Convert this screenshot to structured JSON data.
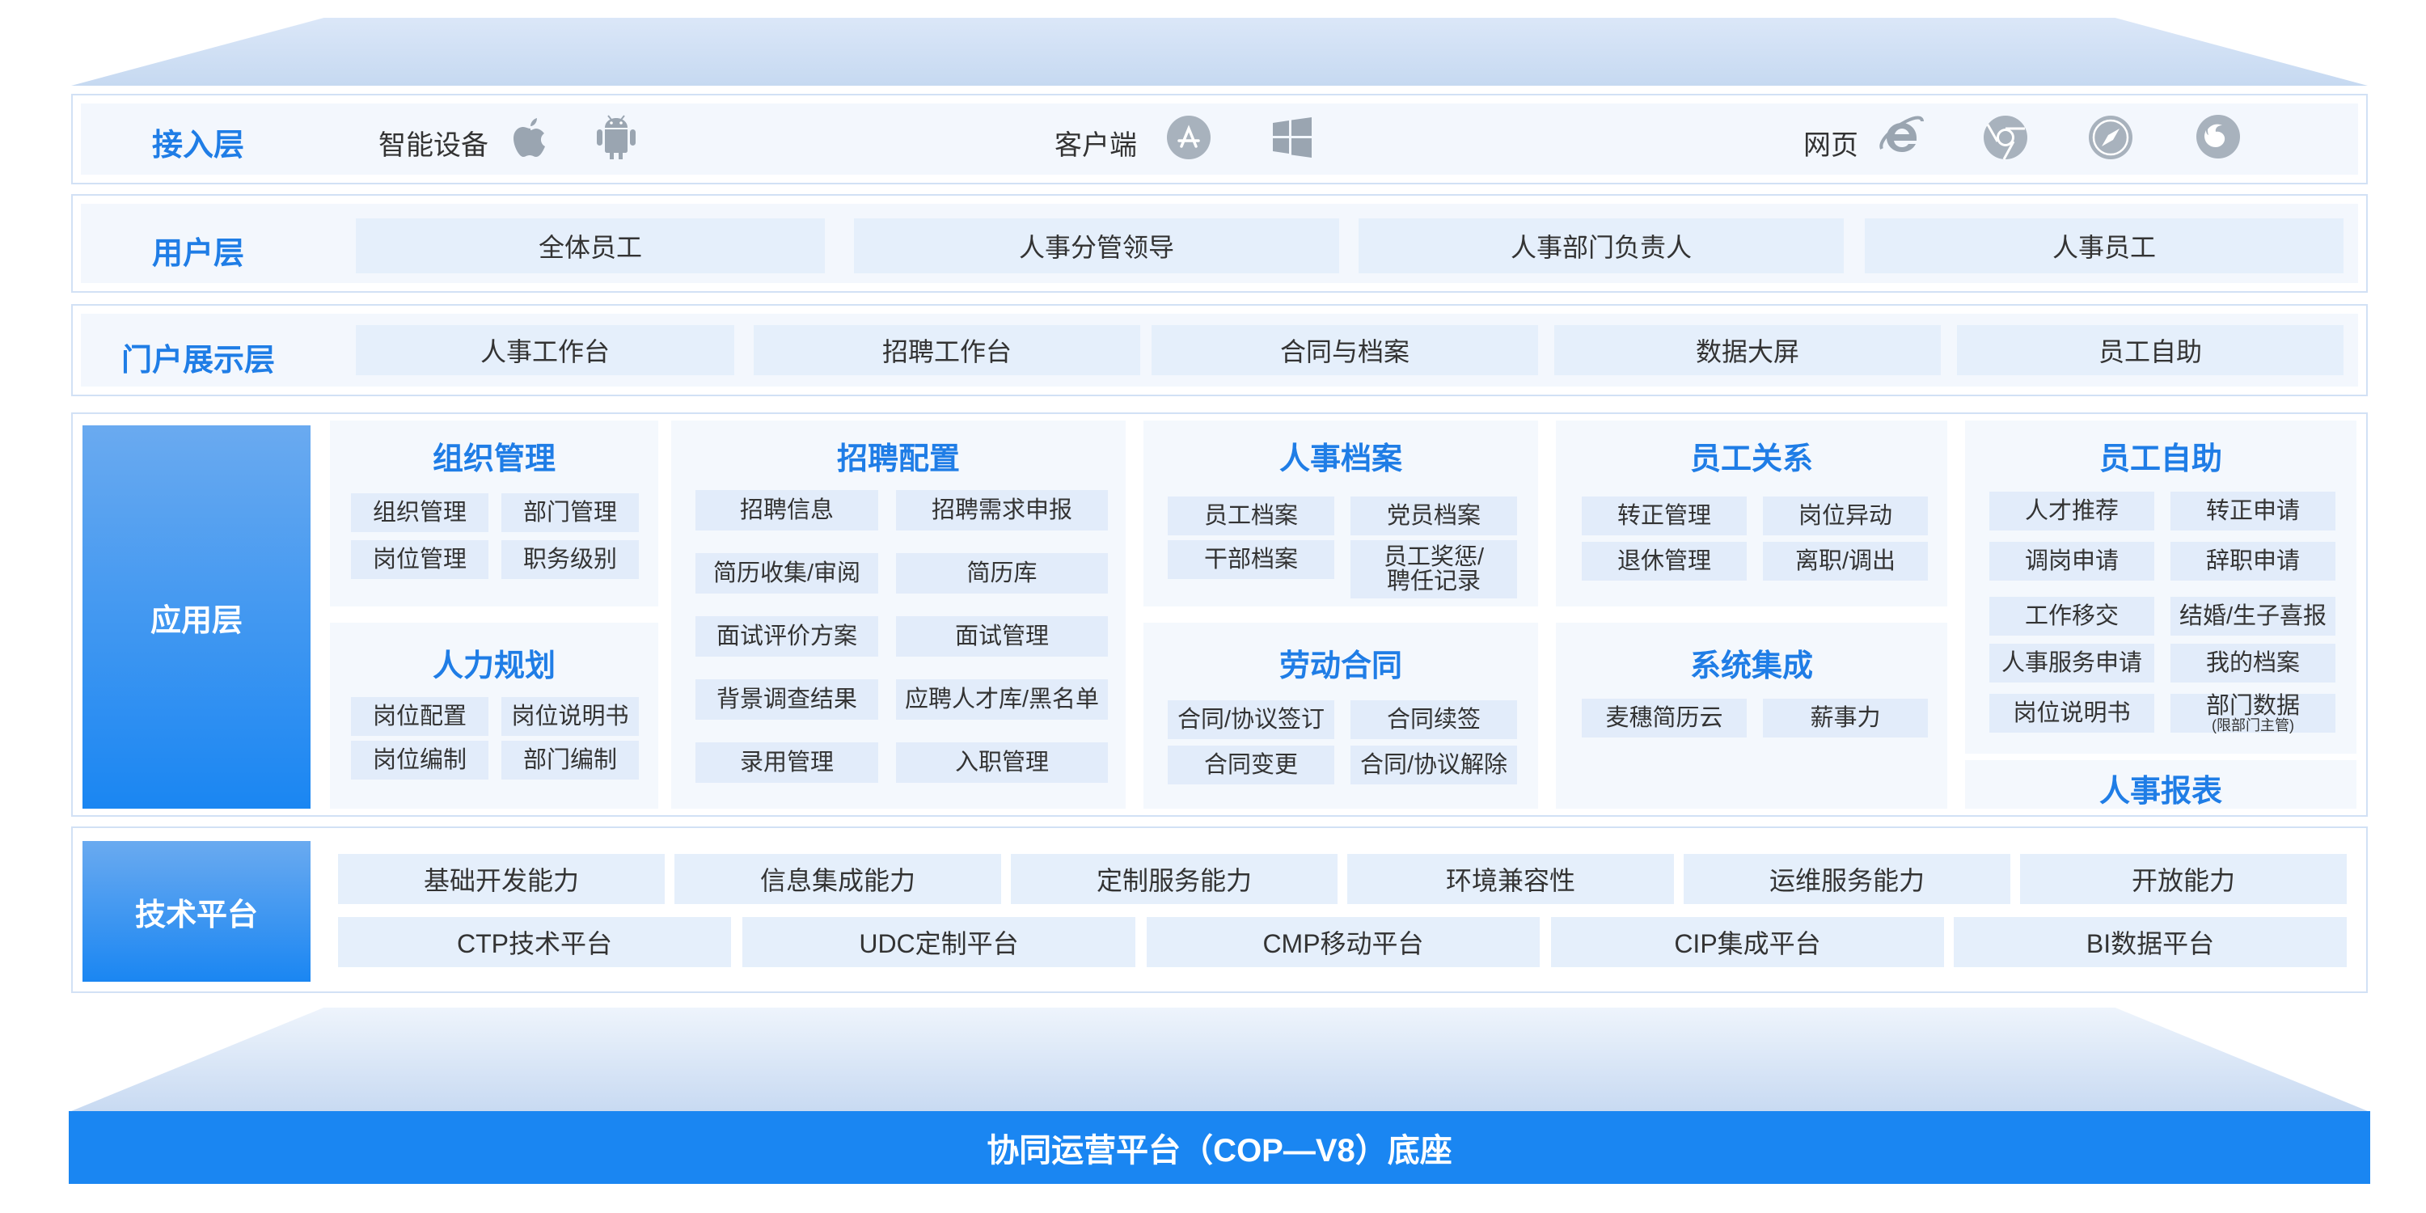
{
  "access_layer": {
    "title": "接入层",
    "groups": [
      {
        "label": "智能设备",
        "icons": [
          "apple-icon",
          "android-icon"
        ]
      },
      {
        "label": "客户端",
        "icons": [
          "app-store-icon",
          "windows-icon"
        ]
      },
      {
        "label": "网页",
        "icons": [
          "ie-icon",
          "chrome-icon",
          "safari-icon",
          "firefox-icon"
        ]
      }
    ]
  },
  "user_layer": {
    "title": "用户层",
    "items": [
      "全体员工",
      "人事分管领导",
      "人事部门负责人",
      "人事员工"
    ]
  },
  "portal_layer": {
    "title": "门户展示层",
    "items": [
      "人事工作台",
      "招聘工作台",
      "合同与档案",
      "数据大屏",
      "员工自助"
    ]
  },
  "app_layer": {
    "title": "应用层",
    "org": {
      "title": "组织管理",
      "items": [
        "组织管理",
        "部门管理",
        "岗位管理",
        "职务级别"
      ]
    },
    "hr_plan": {
      "title": "人力规划",
      "items": [
        "岗位配置",
        "岗位说明书",
        "岗位编制",
        "部门编制"
      ]
    },
    "recruit": {
      "title": "招聘配置",
      "items": [
        "招聘信息",
        "招聘需求申报",
        "简历收集/审阅",
        "简历库",
        "面试评价方案",
        "面试管理",
        "背景调查结果",
        "应聘人才库/黑名单",
        "录用管理",
        "入职管理"
      ]
    },
    "archive": {
      "title": "人事档案",
      "items": [
        "员工档案",
        "党员档案",
        "干部档案",
        "员工奖惩/",
        "聘任记录"
      ]
    },
    "contract": {
      "title": "劳动合同",
      "items": [
        "合同/协议签订",
        "合同续签",
        "合同变更",
        "合同/协议解除"
      ]
    },
    "relation": {
      "title": "员工关系",
      "items": [
        "转正管理",
        "岗位异动",
        "退休管理",
        "离职/调出"
      ]
    },
    "integration": {
      "title": "系统集成",
      "items": [
        "麦穗简历云",
        "薪事力"
      ]
    },
    "self_service": {
      "title": "员工自助",
      "items": [
        "人才推荐",
        "转正申请",
        "调岗申请",
        "辞职申请",
        "工作移交",
        "结婚/生子喜报",
        "人事服务申请",
        "我的档案",
        "岗位说明书",
        "部门数据",
        "(限部门主管)"
      ]
    },
    "report": {
      "title": "人事报表"
    }
  },
  "tech_layer": {
    "title": "技术平台",
    "capabilities": [
      "基础开发能力",
      "信息集成能力",
      "定制服务能力",
      "环境兼容性",
      "运维服务能力",
      "开放能力"
    ],
    "platforms": [
      "CTP技术平台",
      "UDC定制平台",
      "CMP移动平台",
      "CIP集成平台",
      "BI数据平台"
    ]
  },
  "base": {
    "label": "协同运营平台（COP—V8）底座"
  }
}
